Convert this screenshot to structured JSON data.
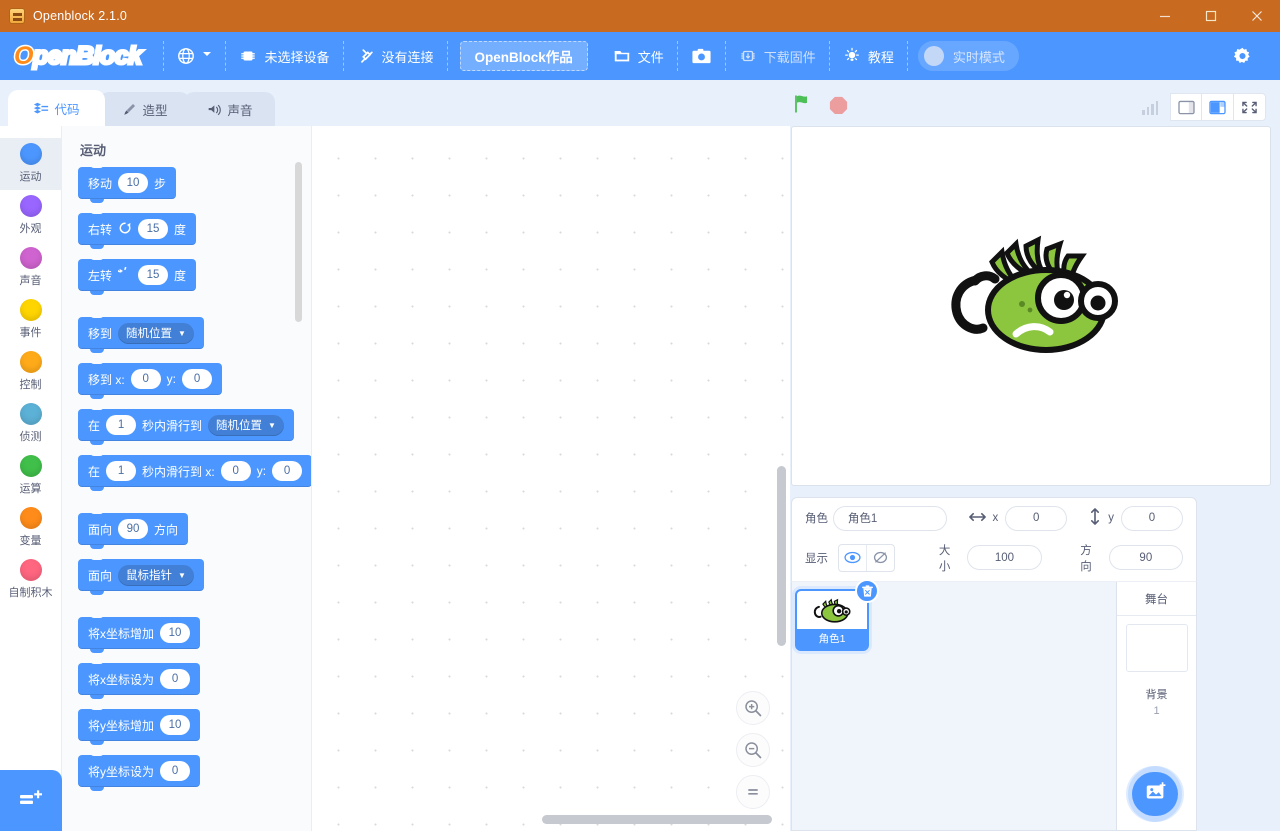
{
  "window": {
    "title": "Openblock 2.1.0",
    "icon": "app-icon",
    "buttons": {
      "minimize": "—",
      "maximize": "□",
      "close": "✕"
    }
  },
  "menubar": {
    "logo": {
      "prefix": "O",
      "rest": "penBlock"
    },
    "language": {
      "label": "",
      "icon": "globe-icon"
    },
    "device": {
      "label": "未选择设备",
      "icon": "chip-icon"
    },
    "connection": {
      "label": "没有连接",
      "icon": "disconnect-icon"
    },
    "project": {
      "label": "OpenBlock作品"
    },
    "file": {
      "label": "文件",
      "icon": "folder-icon"
    },
    "screenshot": {
      "label": "",
      "icon": "camera-icon"
    },
    "firmware": {
      "label": "下载固件",
      "icon": "firmware-icon"
    },
    "tutorial": {
      "label": "教程",
      "icon": "lightbulb-icon"
    },
    "realtime": {
      "label": "实时模式",
      "icon": "toggle-icon"
    },
    "settings": {
      "label": "",
      "icon": "gear-icon"
    }
  },
  "tabs": [
    {
      "label": "代码",
      "icon": "code-icon",
      "active": true
    },
    {
      "label": "造型",
      "icon": "brush-icon",
      "active": false
    },
    {
      "label": "声音",
      "icon": "speaker-icon",
      "active": false
    }
  ],
  "stage_controls": {
    "green_flag": "green-flag-icon",
    "stop": "stop-icon",
    "signal": "signal-icon",
    "small_stage": "small-stage-icon",
    "large_stage": "large-stage-icon",
    "fullscreen": "fullscreen-icon"
  },
  "categories": [
    {
      "label": "运动",
      "color": "#4c97ff",
      "active": true
    },
    {
      "label": "外观",
      "color": "#9966ff",
      "active": false
    },
    {
      "label": "声音",
      "color": "#cf63cf",
      "active": false
    },
    {
      "label": "事件",
      "color": "#ffd500",
      "active": false
    },
    {
      "label": "控制",
      "color": "#ffab19",
      "active": false
    },
    {
      "label": "侦测",
      "color": "#5cb1d6",
      "active": false
    },
    {
      "label": "运算",
      "color": "#40bf4a",
      "active": false
    },
    {
      "label": "变量",
      "color": "#ff8c1a",
      "active": false
    },
    {
      "label": "自制积木",
      "color": "#ff6680",
      "active": false
    }
  ],
  "add_extension": {
    "label": "",
    "icon": "add-extension-icon"
  },
  "palette": {
    "title": "运动",
    "blocks": [
      {
        "id": "move-steps",
        "parts": [
          {
            "t": "text",
            "v": "移动"
          },
          {
            "t": "num",
            "v": "10"
          },
          {
            "t": "text",
            "v": "步"
          }
        ]
      },
      {
        "id": "turn-right",
        "parts": [
          {
            "t": "text",
            "v": "右转"
          },
          {
            "t": "icon",
            "v": "turn-right-icon"
          },
          {
            "t": "num",
            "v": "15"
          },
          {
            "t": "text",
            "v": "度"
          }
        ]
      },
      {
        "id": "turn-left",
        "parts": [
          {
            "t": "text",
            "v": "左转"
          },
          {
            "t": "icon",
            "v": "turn-left-icon"
          },
          {
            "t": "num",
            "v": "15"
          },
          {
            "t": "text",
            "v": "度"
          }
        ],
        "gapAfter": true
      },
      {
        "id": "goto",
        "parts": [
          {
            "t": "text",
            "v": "移到"
          },
          {
            "t": "drop",
            "v": "随机位置"
          }
        ]
      },
      {
        "id": "goto-xy",
        "parts": [
          {
            "t": "text",
            "v": "移到 x:"
          },
          {
            "t": "num",
            "v": "0"
          },
          {
            "t": "text",
            "v": "y:"
          },
          {
            "t": "num",
            "v": "0"
          }
        ]
      },
      {
        "id": "glide-to",
        "parts": [
          {
            "t": "text",
            "v": "在"
          },
          {
            "t": "num",
            "v": "1"
          },
          {
            "t": "text",
            "v": "秒内滑行到"
          },
          {
            "t": "drop",
            "v": "随机位置"
          }
        ]
      },
      {
        "id": "glide-to-xy",
        "parts": [
          {
            "t": "text",
            "v": "在"
          },
          {
            "t": "num",
            "v": "1"
          },
          {
            "t": "text",
            "v": "秒内滑行到 x:"
          },
          {
            "t": "num",
            "v": "0"
          },
          {
            "t": "text",
            "v": "y:"
          },
          {
            "t": "num",
            "v": "0"
          }
        ],
        "gapAfter": true
      },
      {
        "id": "point-direction",
        "parts": [
          {
            "t": "text",
            "v": "面向"
          },
          {
            "t": "num",
            "v": "90"
          },
          {
            "t": "text",
            "v": "方向"
          }
        ]
      },
      {
        "id": "point-towards",
        "parts": [
          {
            "t": "text",
            "v": "面向"
          },
          {
            "t": "drop",
            "v": "鼠标指针"
          }
        ],
        "gapAfter": true
      },
      {
        "id": "change-x-by",
        "parts": [
          {
            "t": "text",
            "v": "将x坐标增加"
          },
          {
            "t": "num",
            "v": "10"
          }
        ]
      },
      {
        "id": "set-x-to",
        "parts": [
          {
            "t": "text",
            "v": "将x坐标设为"
          },
          {
            "t": "num",
            "v": "0"
          }
        ]
      },
      {
        "id": "change-y-by",
        "parts": [
          {
            "t": "text",
            "v": "将y坐标增加"
          },
          {
            "t": "num",
            "v": "10"
          }
        ]
      },
      {
        "id": "set-y-to",
        "parts": [
          {
            "t": "text",
            "v": "将y坐标设为"
          },
          {
            "t": "num",
            "v": "0"
          }
        ]
      }
    ]
  },
  "workspace": {
    "zoom_in": "zoom-in-icon",
    "zoom_out": "zoom-out-icon",
    "zoom_reset": "zoom-reset-icon"
  },
  "sprite_info": {
    "name_label": "角色",
    "name_value": "角色1",
    "x_label": "x",
    "x_value": "0",
    "y_label": "y",
    "y_value": "0",
    "show_label": "显示",
    "size_label": "大小",
    "size_value": "100",
    "direction_label": "方向",
    "direction_value": "90"
  },
  "sprite_list": [
    {
      "name": "角色1",
      "selected": true
    }
  ],
  "stage_panel": {
    "header": "舞台",
    "backdrop_label": "背景",
    "backdrop_count": "1"
  },
  "fabs": {
    "add_sprite": "add-sprite-icon",
    "add_backdrop": "add-backdrop-icon"
  }
}
